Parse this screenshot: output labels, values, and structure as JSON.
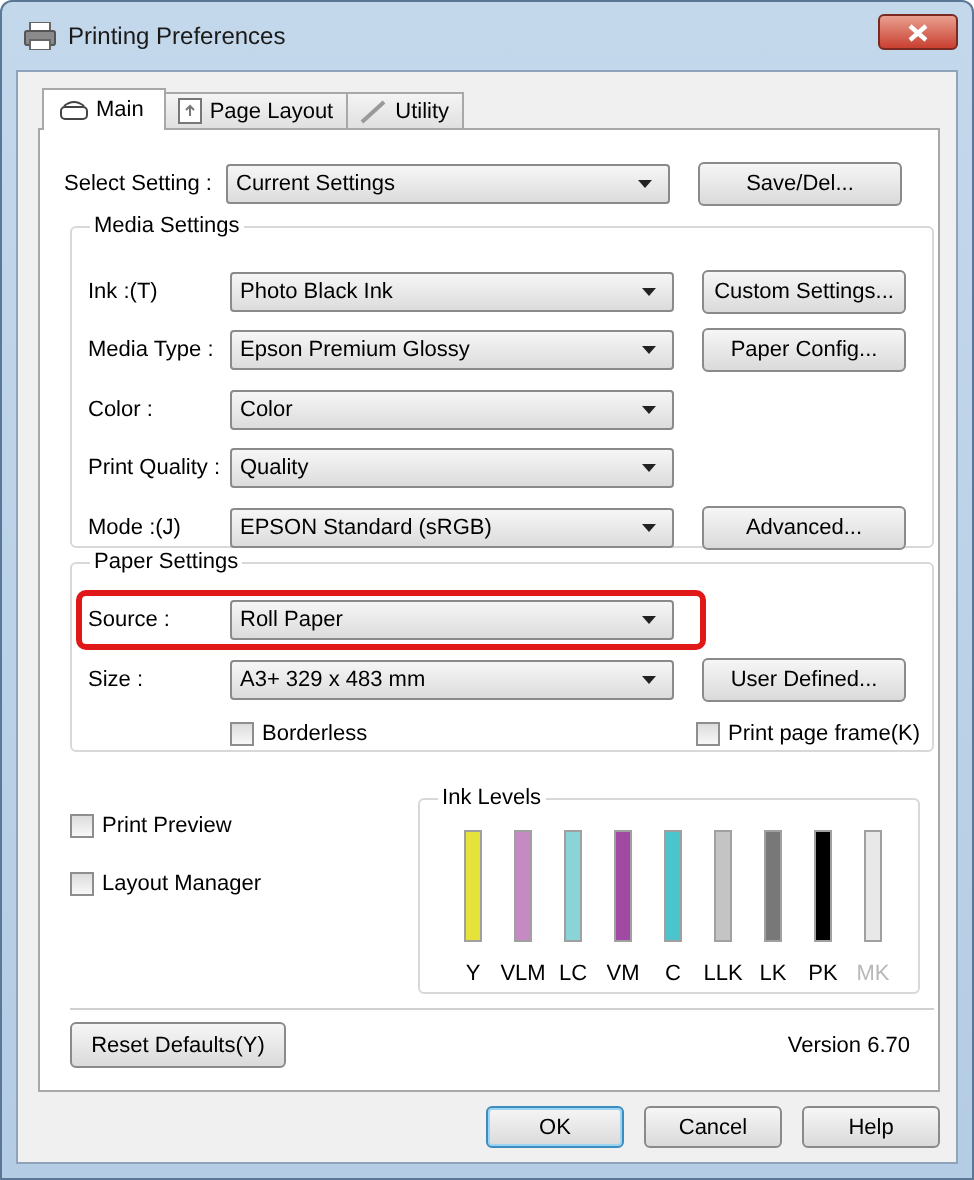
{
  "window": {
    "title": "Printing Preferences"
  },
  "tabs": [
    {
      "label": "Main",
      "selected": true
    },
    {
      "label": "Page Layout",
      "selected": false
    },
    {
      "label": "Utility",
      "selected": false
    }
  ],
  "select_setting": {
    "label": "Select Setting :",
    "value": "Current Settings",
    "button": "Save/Del..."
  },
  "media_settings": {
    "title": "Media Settings",
    "rows": [
      {
        "label": "Ink :(T)",
        "value": "Photo Black Ink",
        "button": "Custom Settings..."
      },
      {
        "label": "Media Type :",
        "value": "Epson Premium Glossy",
        "button": "Paper Config..."
      },
      {
        "label": "Color :",
        "value": "Color"
      },
      {
        "label": "Print Quality :",
        "value": "Quality"
      },
      {
        "label": "Mode :(J)",
        "value": "EPSON Standard (sRGB)",
        "button": "Advanced..."
      }
    ]
  },
  "paper_settings": {
    "title": "Paper Settings",
    "rows": [
      {
        "label": "Source :",
        "value": "Roll Paper",
        "highlighted": true
      },
      {
        "label": "Size :",
        "value": "A3+ 329 x 483 mm",
        "button": "User Defined...",
        "highlighted": false
      }
    ],
    "checkboxes": [
      {
        "label": "Borderless",
        "checked": false
      },
      {
        "label": "Print page frame(K)",
        "checked": false
      }
    ]
  },
  "options": [
    {
      "label": "Print Preview",
      "checked": false
    },
    {
      "label": "Layout Manager",
      "checked": false
    }
  ],
  "ink_levels": {
    "title": "Ink Levels",
    "inks": [
      {
        "name": "Y",
        "color": "#e6e23c",
        "level": 1,
        "disabled": false
      },
      {
        "name": "VLM",
        "color": "#c58ac4",
        "level": 1,
        "disabled": false
      },
      {
        "name": "LC",
        "color": "#8ad4d8",
        "level": 1,
        "disabled": false
      },
      {
        "name": "VM",
        "color": "#a04aa4",
        "level": 1,
        "disabled": false
      },
      {
        "name": "C",
        "color": "#4cc4cc",
        "level": 1,
        "disabled": false
      },
      {
        "name": "LLK",
        "color": "#c4c4c4",
        "level": 1,
        "disabled": false
      },
      {
        "name": "LK",
        "color": "#787878",
        "level": 1,
        "disabled": false
      },
      {
        "name": "PK",
        "color": "#000000",
        "level": 1,
        "disabled": false
      },
      {
        "name": "MK",
        "color": "#e8e8e8",
        "level": 1,
        "disabled": true
      }
    ]
  },
  "reset_button": "Reset Defaults(Y)",
  "version": "Version 6.70",
  "buttons": [
    {
      "label": "OK",
      "default": true
    },
    {
      "label": "Cancel",
      "default": false
    },
    {
      "label": "Help",
      "default": false
    }
  ]
}
